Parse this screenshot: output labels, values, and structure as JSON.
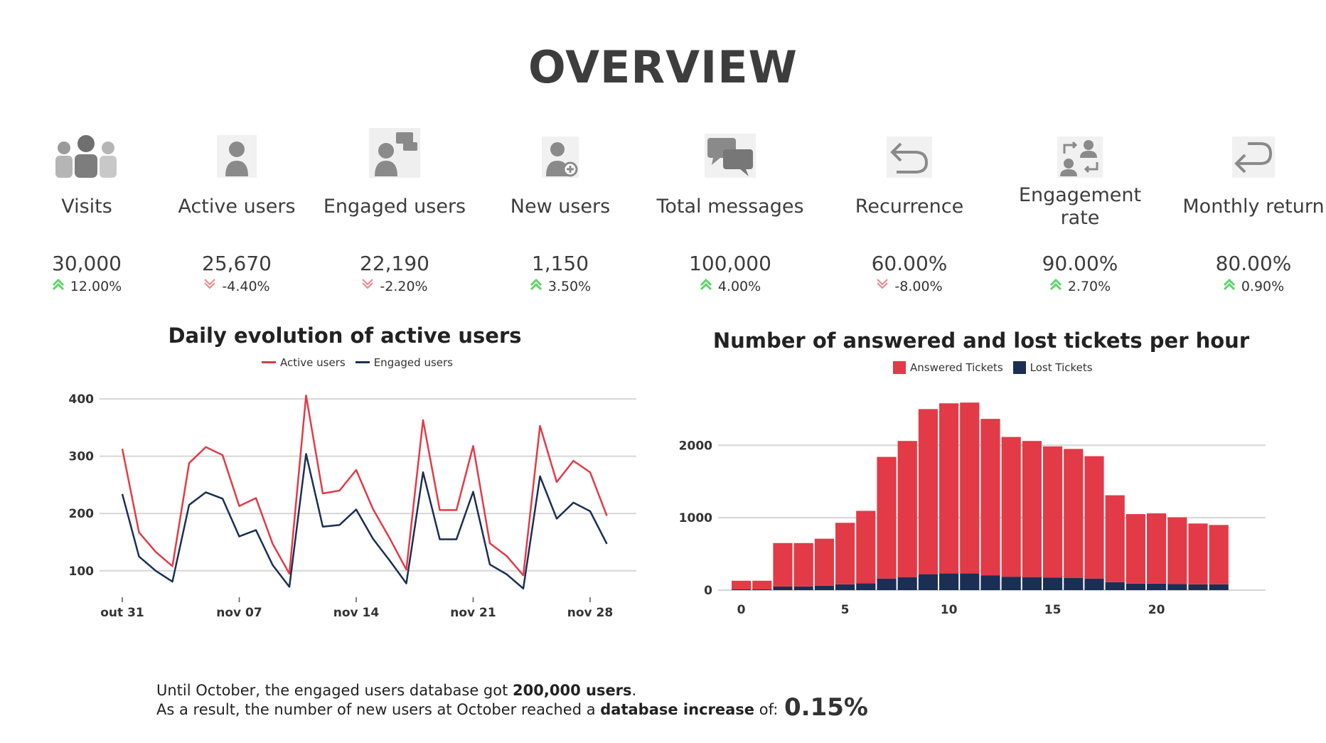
{
  "page": {
    "title": "OVERVIEW"
  },
  "kpis": [
    {
      "label": "Visits",
      "value": "30,000",
      "delta": "12.00%",
      "trend": "up",
      "icon": "visitors-group-icon"
    },
    {
      "label": "Active users",
      "value": "25,670",
      "delta": "-4.40%",
      "trend": "down",
      "icon": "user-icon"
    },
    {
      "label": "Engaged users",
      "value": "22,190",
      "delta": "-2.20%",
      "trend": "down",
      "icon": "user-chat-icon"
    },
    {
      "label": "New users",
      "value": "1,150",
      "delta": "3.50%",
      "trend": "up",
      "icon": "add-user-icon"
    },
    {
      "label": "Total messages",
      "value": "100,000",
      "delta": "4.00%",
      "trend": "up",
      "icon": "messages-icon"
    },
    {
      "label": "Recurrence",
      "value": "60.00%",
      "delta": "-8.00%",
      "trend": "down",
      "icon": "undo-arrow-icon"
    },
    {
      "label": "Engagement rate",
      "value": "90.00%",
      "delta": "2.70%",
      "trend": "up",
      "icon": "users-exchange-icon"
    },
    {
      "label": "Monthly return",
      "value": "80.00%",
      "delta": "0.90%",
      "trend": "up",
      "icon": "return-arrow-icon"
    }
  ],
  "colors": {
    "up": "#5fd46a",
    "down": "#e8868a",
    "red": "#e23a47",
    "navy": "#1b2f55",
    "grid": "#d6d6d6",
    "icon": "#8a8a8a"
  },
  "chart_data": [
    {
      "type": "line",
      "title": "Daily evolution of active users",
      "x_ticks": [
        "out 31",
        "nov 07",
        "nov 14",
        "nov 21",
        "nov 28"
      ],
      "x": [
        "out 31",
        "nov 01",
        "nov 02",
        "nov 03",
        "nov 04",
        "nov 05",
        "nov 06",
        "nov 07",
        "nov 08",
        "nov 09",
        "nov 10",
        "nov 11",
        "nov 12",
        "nov 13",
        "nov 14",
        "nov 15",
        "nov 16",
        "nov 17",
        "nov 18",
        "nov 19",
        "nov 20",
        "nov 21",
        "nov 22",
        "nov 23",
        "nov 24",
        "nov 25",
        "nov 26",
        "nov 27",
        "nov 28",
        "nov 29",
        "nov 30"
      ],
      "series": [
        {
          "name": "Active users",
          "color": "#e23a47",
          "values": [
            313,
            167,
            133,
            108,
            288,
            316,
            302,
            213,
            227,
            147,
            95,
            406,
            235,
            240,
            276,
            208,
            157,
            102,
            363,
            206,
            206,
            318,
            148,
            126,
            92,
            353,
            255,
            292,
            272,
            196
          ]
        },
        {
          "name": "Engaged users",
          "color": "#1b2f55",
          "values": [
            234,
            125,
            100,
            81,
            215,
            237,
            226,
            160,
            171,
            110,
            72,
            304,
            177,
            180,
            207,
            156,
            118,
            78,
            272,
            155,
            155,
            238,
            111,
            94,
            69,
            265,
            191,
            219,
            204,
            147
          ]
        }
      ],
      "y_ticks": [
        100,
        200,
        300,
        400
      ],
      "ylim": [
        60,
        420
      ],
      "grid": true,
      "legend": "top-center"
    },
    {
      "type": "bar",
      "stacked": true,
      "title": "Number of answered and lost tickets per hour",
      "x": [
        0,
        1,
        2,
        3,
        4,
        5,
        6,
        7,
        8,
        9,
        10,
        11,
        12,
        13,
        14,
        15,
        16,
        17,
        18,
        19,
        20,
        21,
        22,
        23
      ],
      "x_ticks": [
        0,
        5,
        10,
        15,
        20
      ],
      "series": [
        {
          "name": "Answered Tickets",
          "color": "#e23a47",
          "values": [
            120,
            120,
            600,
            600,
            650,
            850,
            1000,
            1680,
            1880,
            2280,
            2350,
            2360,
            2160,
            1930,
            1880,
            1810,
            1780,
            1690,
            1200,
            960,
            970,
            920,
            840,
            820
          ]
        },
        {
          "name": "Lost Tickets",
          "color": "#1b2f55",
          "values": [
            10,
            10,
            50,
            50,
            60,
            80,
            95,
            160,
            180,
            220,
            230,
            230,
            205,
            185,
            180,
            175,
            170,
            160,
            110,
            90,
            90,
            85,
            80,
            80
          ]
        }
      ],
      "y_ticks": [
        0,
        1000,
        2000
      ],
      "ylim": [
        0,
        2700
      ],
      "grid": true,
      "legend": "top-center"
    }
  ],
  "footer": {
    "line1_pre": "Until October, the engaged users database got ",
    "line1_bold": "200,000 users",
    "line1_post": ".",
    "line2_pre": "As a result, the number of new users at October reached a ",
    "line2_bold": "database increase",
    "line2_post": " of:",
    "result": "0.15%"
  }
}
